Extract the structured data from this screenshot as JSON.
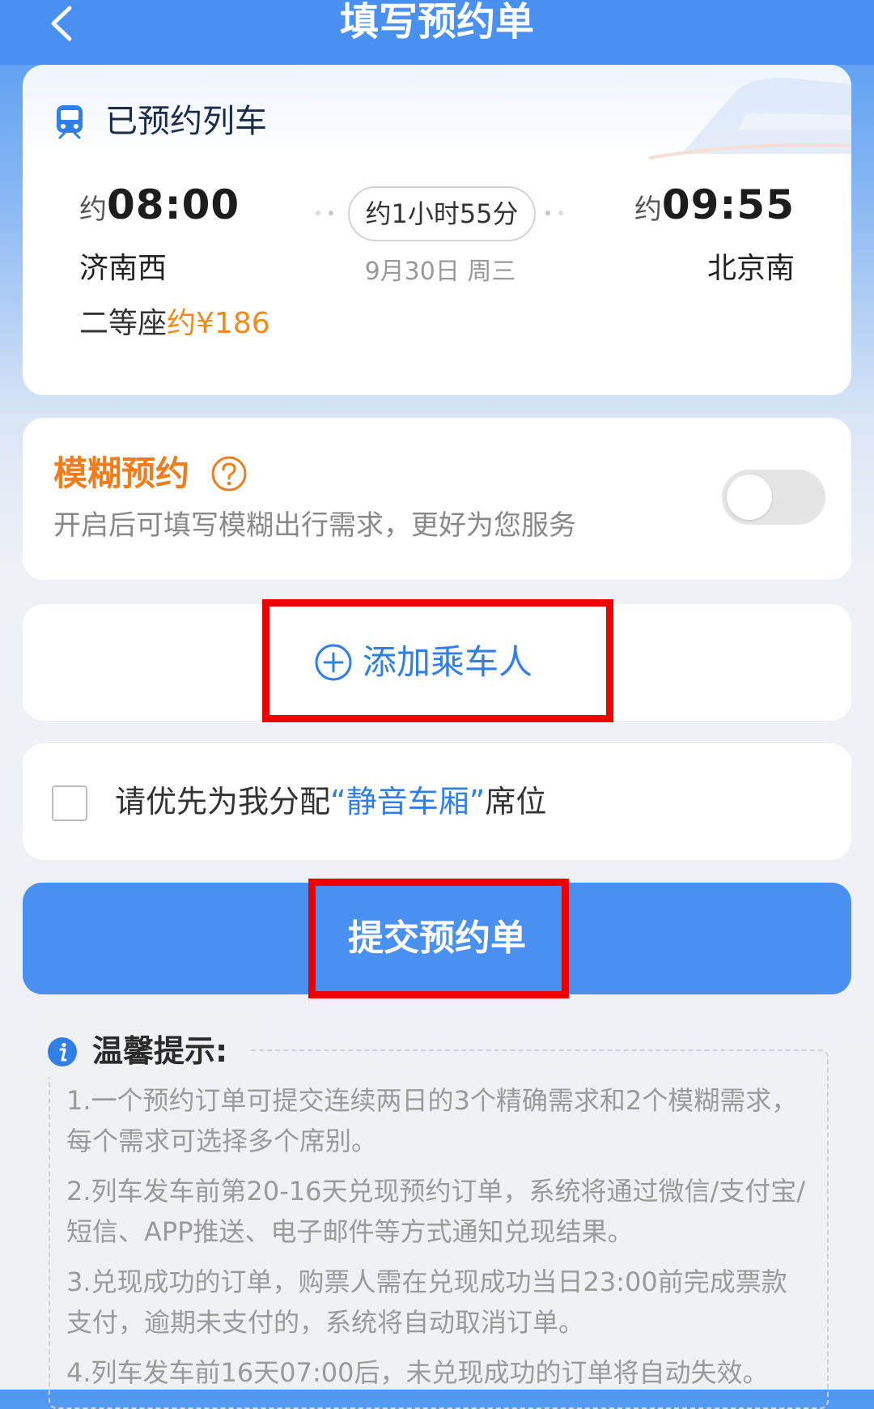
{
  "header": {
    "title": "填写预约单"
  },
  "train": {
    "section_label": "已预约列车",
    "depart": {
      "approx": "约",
      "time": "08:00",
      "station": "济南西"
    },
    "arrive": {
      "approx": "约",
      "time": "09:55",
      "station": "北京南"
    },
    "duration": "约1小时55分",
    "date": "9月30日 周三",
    "seat_class": "二等座",
    "price": "约¥186"
  },
  "fuzzy": {
    "title": "模糊预约",
    "description": "开启后可填写模糊出行需求，更好为您服务",
    "enabled": false
  },
  "passenger": {
    "add_label": "添加乘车人"
  },
  "quiet_car": {
    "prefix": "请优先为我分配",
    "highlight": "“静音车厢”",
    "suffix": "席位",
    "checked": false
  },
  "submit": {
    "label": "提交预约单"
  },
  "tips": {
    "title": "温馨提示:",
    "items": [
      "1.一个预约订单可提交连续两日的3个精确需求和2个模糊需求，每个需求可选择多个席别。",
      "2.列车发车前第20-16天兑现预约订单，系统将通过微信/支付宝/短信、APP推送、电子邮件等方式通知兑现结果。",
      "3.兑现成功的订单，购票人需在兑现成功当日23:00前完成票款支付，逾期未支付的，系统将自动取消订单。",
      "4.列车发车前16天07:00后，未兑现成功的订单将自动失效。"
    ]
  },
  "colors": {
    "primary": "#4a90f0",
    "accent_orange": "#f07d1d",
    "highlight_red": "#ee0000"
  }
}
